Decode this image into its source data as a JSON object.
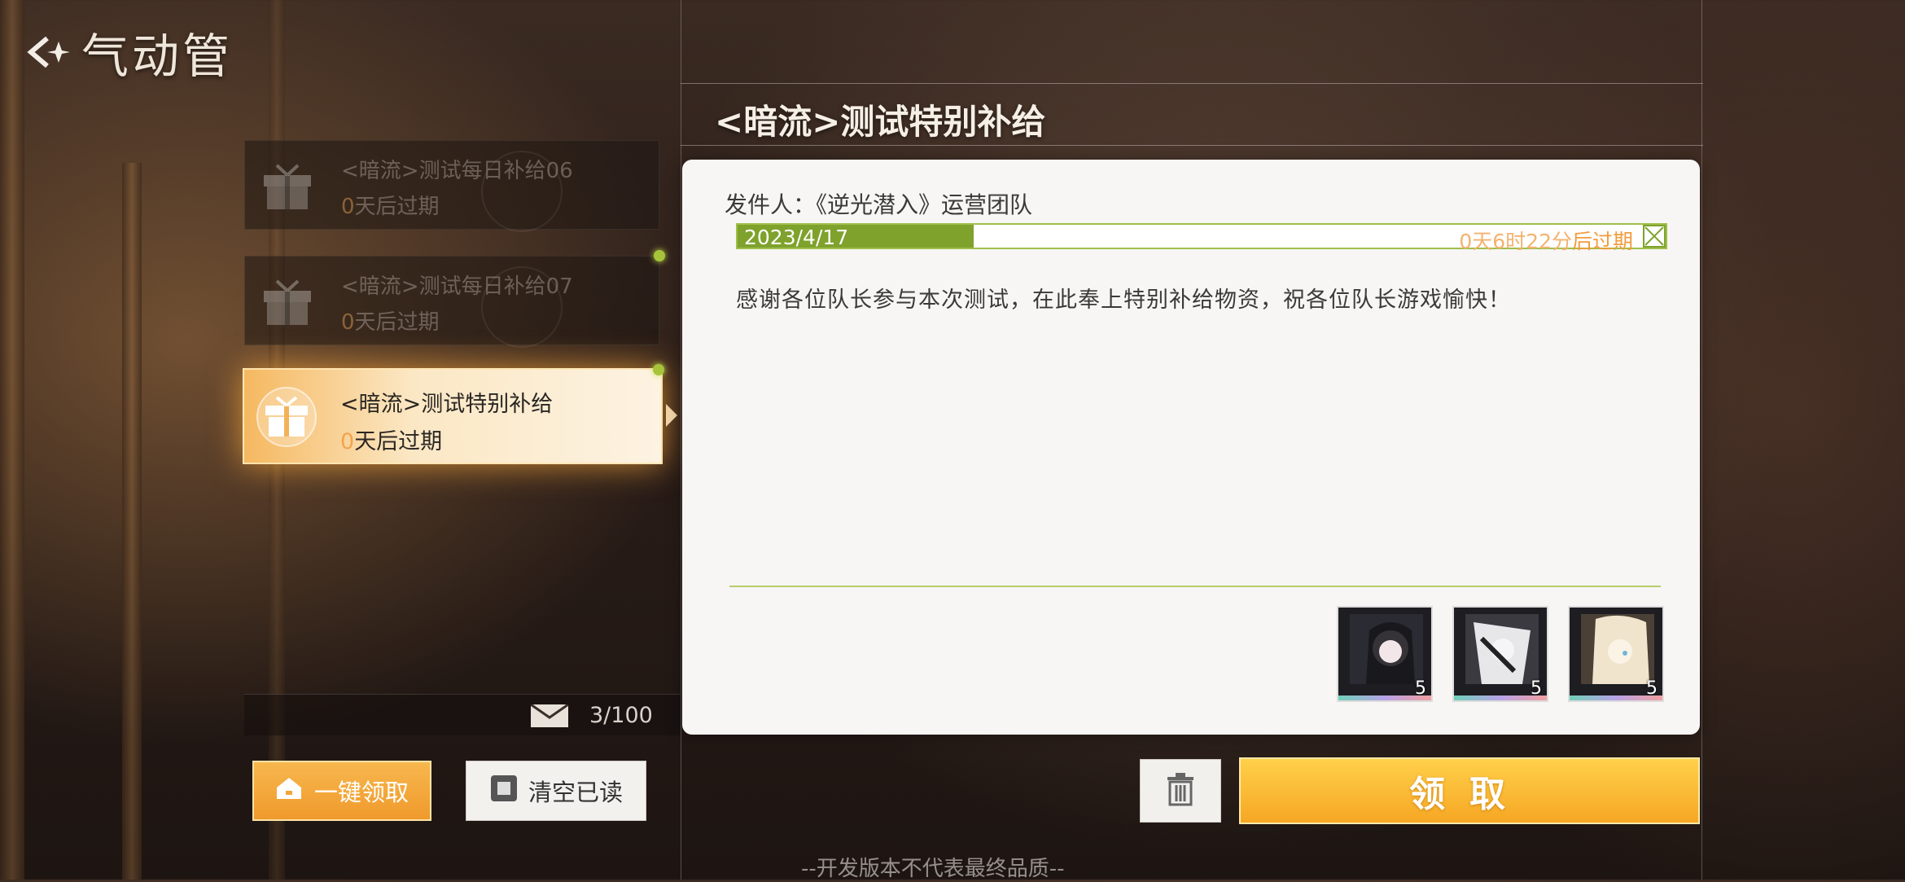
{
  "header": {
    "title": "气动管",
    "back_icon": "back-arrow-icon"
  },
  "mail_list": {
    "items": [
      {
        "title": "<暗流>测试每日补给06",
        "expire_num": "0",
        "expire_suffix": "天后过期",
        "state": "read"
      },
      {
        "title": "<暗流>测试每日补给07",
        "expire_num": "0",
        "expire_suffix": "天后过期",
        "state": "read"
      },
      {
        "title": "<暗流>测试特别补给",
        "expire_num": "0",
        "expire_suffix": "天后过期",
        "state": "selected"
      }
    ],
    "count": "3/100"
  },
  "buttons": {
    "claim_all": "一键领取",
    "clear_read": "清空已读",
    "claim": "领取"
  },
  "detail": {
    "title": "<暗流>测试特别补给",
    "sender": "发件人：《逆光潜入》运营团队",
    "date": "2023/4/17",
    "expire_time": "0天6时22分",
    "expire_suffix": "后过期",
    "body": "感谢各位队长参与本次测试，在此奉上特别补给物资，祝各位队长游戏愉快！",
    "rewards": [
      {
        "qty": "5"
      },
      {
        "qty": "5"
      },
      {
        "qty": "5"
      }
    ]
  },
  "footer": {
    "watermark": "--开发版本不代表最终品质--"
  },
  "colors": {
    "accent_orange": "#f6a724",
    "accent_green": "#7ea22c",
    "expire_orange": "#f4b26f"
  }
}
